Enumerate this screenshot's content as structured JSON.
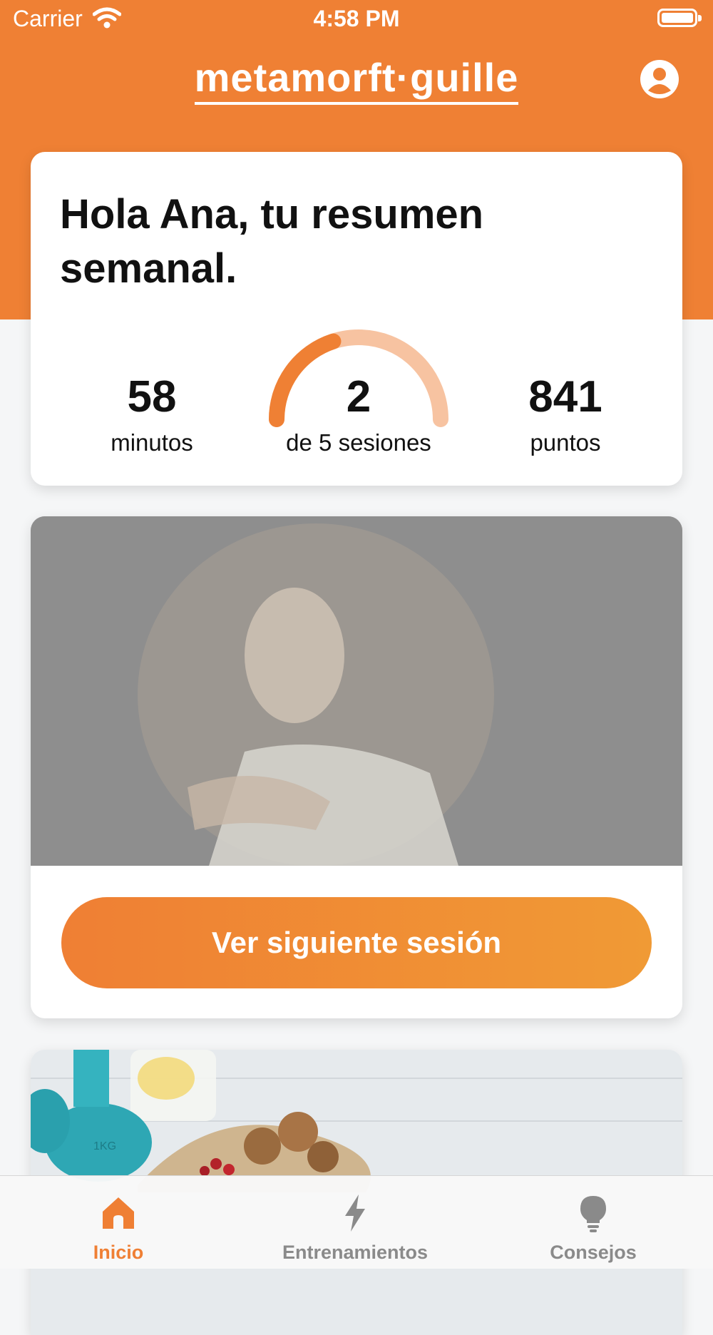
{
  "status_bar": {
    "carrier": "Carrier",
    "time": "4:58 PM"
  },
  "header": {
    "logo": "metamorft·guille"
  },
  "summary": {
    "title": "Hola Ana, tu resumen semanal.",
    "minutes_value": "58",
    "minutes_label": "minutos",
    "sessions_value": "2",
    "sessions_label": "de 5 sesiones",
    "sessions_done": 2,
    "sessions_total": 5,
    "points_value": "841",
    "points_label": "puntos"
  },
  "next_session": {
    "button_label": "Ver siguiente sesión"
  },
  "tabs": [
    {
      "label": "Inicio",
      "icon": "home-icon",
      "active": true
    },
    {
      "label": "Entrenamientos",
      "icon": "lightning-icon",
      "active": false
    },
    {
      "label": "Consejos",
      "icon": "lightbulb-icon",
      "active": false
    }
  ],
  "colors": {
    "accent": "#ef8034",
    "accent_light": "#f7c3a1",
    "inactive_tab": "#8a8a8a"
  }
}
